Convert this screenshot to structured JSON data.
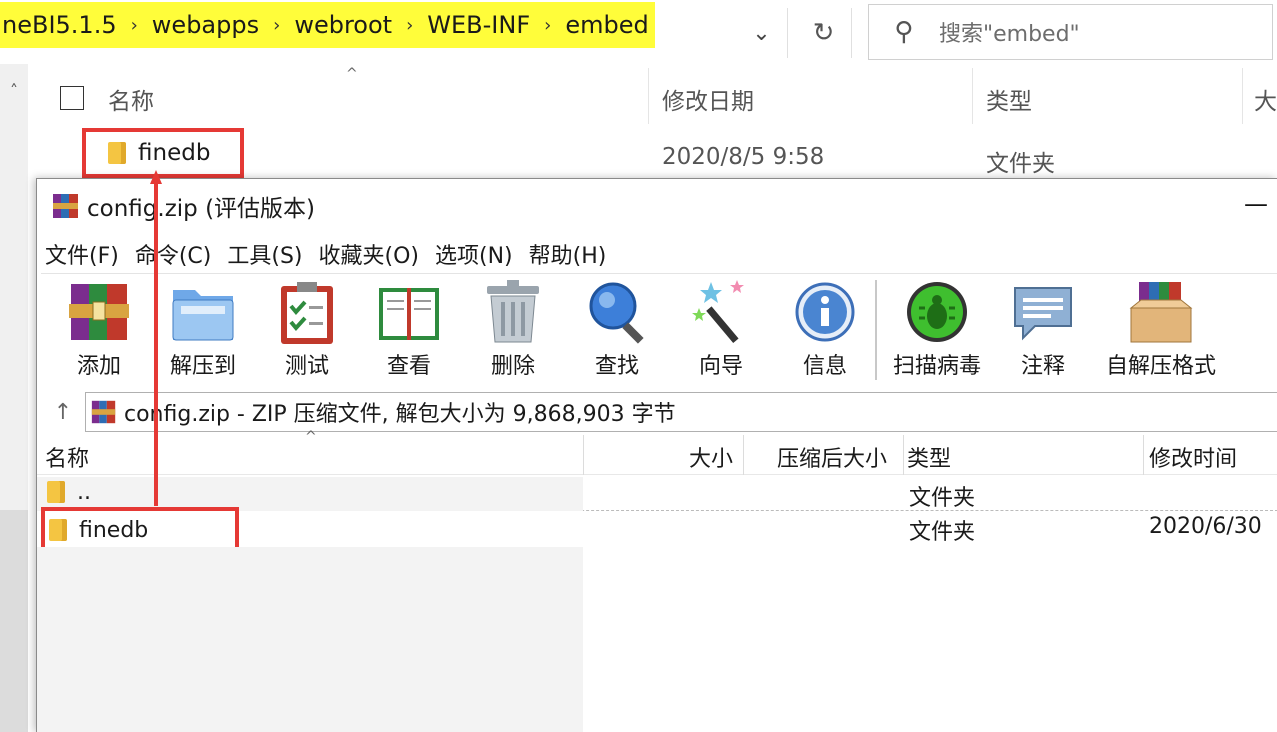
{
  "explorer": {
    "breadcrumb": [
      "neBI5.1.5",
      "webapps",
      "webroot",
      "WEB-INF",
      "embed"
    ],
    "search_placeholder": "搜索\"embed\"",
    "columns": {
      "name": "名称",
      "modified": "修改日期",
      "type": "类型",
      "size": "大"
    },
    "rows": [
      {
        "name": "finedb",
        "modified": "2020/8/5 9:58",
        "type": "文件夹"
      }
    ]
  },
  "rar": {
    "title": "config.zip (评估版本)",
    "menu": [
      "文件(F)",
      "命令(C)",
      "工具(S)",
      "收藏夹(O)",
      "选项(N)",
      "帮助(H)"
    ],
    "toolbar": [
      "添加",
      "解压到",
      "测试",
      "查看",
      "删除",
      "查找",
      "向导",
      "信息",
      "扫描病毒",
      "注释",
      "自解压格式"
    ],
    "path_text": "config.zip - ZIP 压缩文件, 解包大小为 9,868,903 字节",
    "columns": {
      "name": "名称",
      "size": "大小",
      "packed": "压缩后大小",
      "type": "类型",
      "modified": "修改时间"
    },
    "rows": [
      {
        "name": "..",
        "type": "文件夹",
        "modified": ""
      },
      {
        "name": "finedb",
        "type": "文件夹",
        "modified": "2020/6/30"
      }
    ]
  },
  "colors": {
    "highlight": "#fffd3a",
    "annotation": "#e53935",
    "folder": "#f4c542"
  }
}
